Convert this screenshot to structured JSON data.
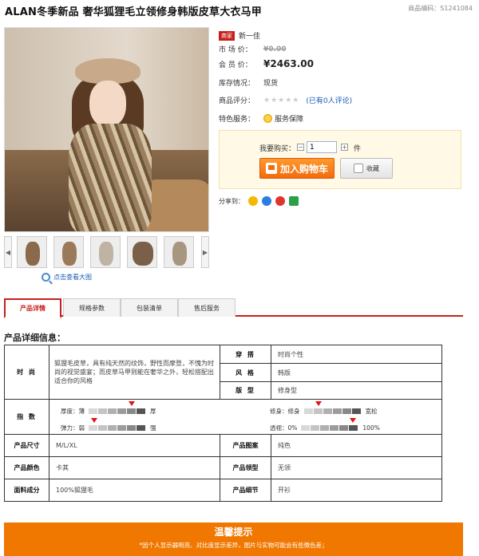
{
  "product": {
    "title": "ALAN冬季新品  奢华狐狸毛立领修身韩版皮草大衣马甲",
    "code": "商品编码：S1241084",
    "badge": "商家",
    "seller": "新一佳",
    "market_price_label": "市 场 价：",
    "market_price": "¥0.00",
    "member_price_label": "会 员 价：",
    "member_price": "¥2463.00",
    "stock_label": "库存情况：",
    "stock": "现货",
    "rating_label": "商品评分：",
    "rating_stars": "★★★★★",
    "rating_link": "(已有0人评论)",
    "service_label": "特色服务：",
    "service": "服务保障"
  },
  "gallery": {
    "zoom_link": "点击查看大图",
    "prev": "◀",
    "next": "▶"
  },
  "buy": {
    "qty_label": "我要购买：",
    "qty_minus": "−",
    "qty_value": "1",
    "qty_plus": "+",
    "unit": "件",
    "cart_label": "加入购物车",
    "fav_label": "收藏",
    "share_label": "分享到："
  },
  "tabs": [
    "产品详情",
    "规格参数",
    "包装清单",
    "售后服务"
  ],
  "detail": {
    "section_title": "产品详细信息：",
    "style_label": "时 尚",
    "style_desc": "狐狸毛皮草，具有纯天然的纹饰，野性而摩登，不愧为时尚的视觉盛宴；而皮草马甲则能在奢华之外，轻松搭配出适合你的风格",
    "match_label": "穿 搭",
    "match_value": "时尚个性",
    "style2_label": "风 格",
    "style2_value": "韩版",
    "shape_label": "版 型",
    "shape_value": "修身型",
    "index_label": "指 数",
    "thickness": {
      "label": "厚度：",
      "left": "薄",
      "right": "厚",
      "level": 0.75
    },
    "elasticity": {
      "label": "弹力：",
      "left": "弱",
      "right": "强",
      "level": 0.1
    },
    "fit": {
      "label": "修身：",
      "left": "修身",
      "right": "宽松",
      "level": 0.25
    },
    "transparency": {
      "label": "透视：",
      "left": "0%",
      "right": "100%",
      "level": 0.9
    },
    "size_label": "产品尺寸",
    "size_value": "M/L/XL",
    "pattern_label": "产品图案",
    "pattern_value": "纯色",
    "color_label": "产品颜色",
    "color_value": "卡其",
    "collar_label": "产品领型",
    "collar_value": "无领",
    "material_label": "面料成分",
    "material_value": "100%狐狸毛",
    "detail_label": "产品细节",
    "detail_value": "开衫"
  },
  "notice": {
    "title": "温馨提示",
    "text": "*因个人显示器明亮、对比度显示差异，图片与实物可能会有些微色差；"
  },
  "colors": {
    "accent": "#c7201c",
    "orange": "#f07800",
    "link": "#1a5ab5"
  }
}
